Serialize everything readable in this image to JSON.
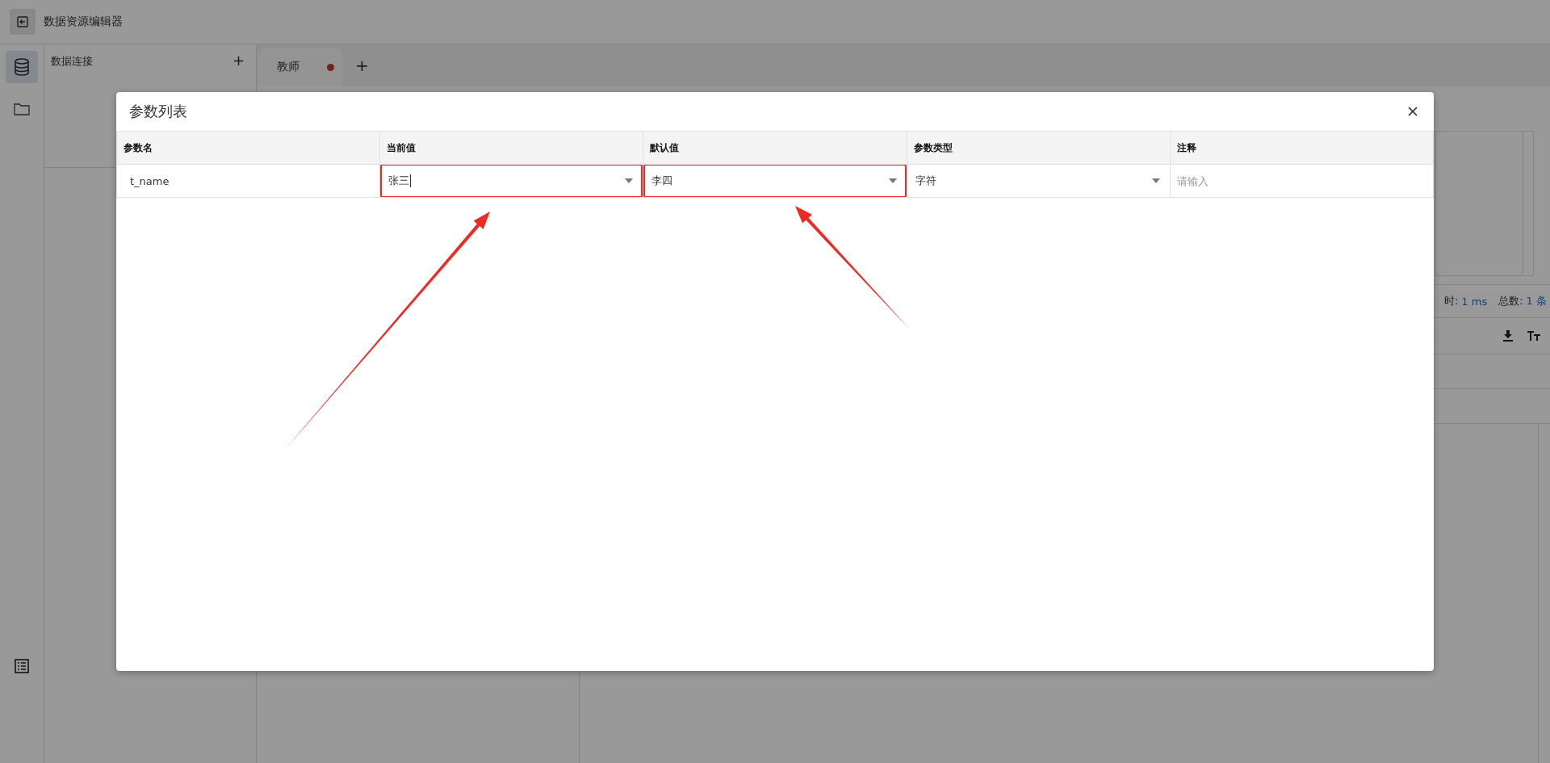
{
  "app": {
    "title": "数据资源编辑器"
  },
  "rail": [
    {
      "kind": "database",
      "selected": true
    },
    {
      "kind": "folder",
      "selected": false
    },
    {
      "kind": "list",
      "selected": false
    }
  ],
  "connections_panel": {
    "title": "数据连接",
    "add": "+"
  },
  "tabs": [
    {
      "label": "教师",
      "unsaved": true
    }
  ],
  "add_tab": "+",
  "result_bar": {
    "time_label": "时:",
    "time_value": "1 ms",
    "count_label": "总数:",
    "count_value": "1 条"
  },
  "dialog": {
    "title": "参数列表",
    "columns": [
      "参数名",
      "当前值",
      "默认值",
      "参数类型",
      "注释"
    ],
    "rows": [
      {
        "name": "t_name",
        "current": {
          "value": "张三",
          "highlighted": true,
          "focused": true
        },
        "default": {
          "value": "李四",
          "highlighted": true,
          "focused": false
        },
        "type": {
          "value": "字符",
          "highlighted": false,
          "focused": false
        },
        "comment": {
          "placeholder": "请输入"
        }
      }
    ]
  }
}
